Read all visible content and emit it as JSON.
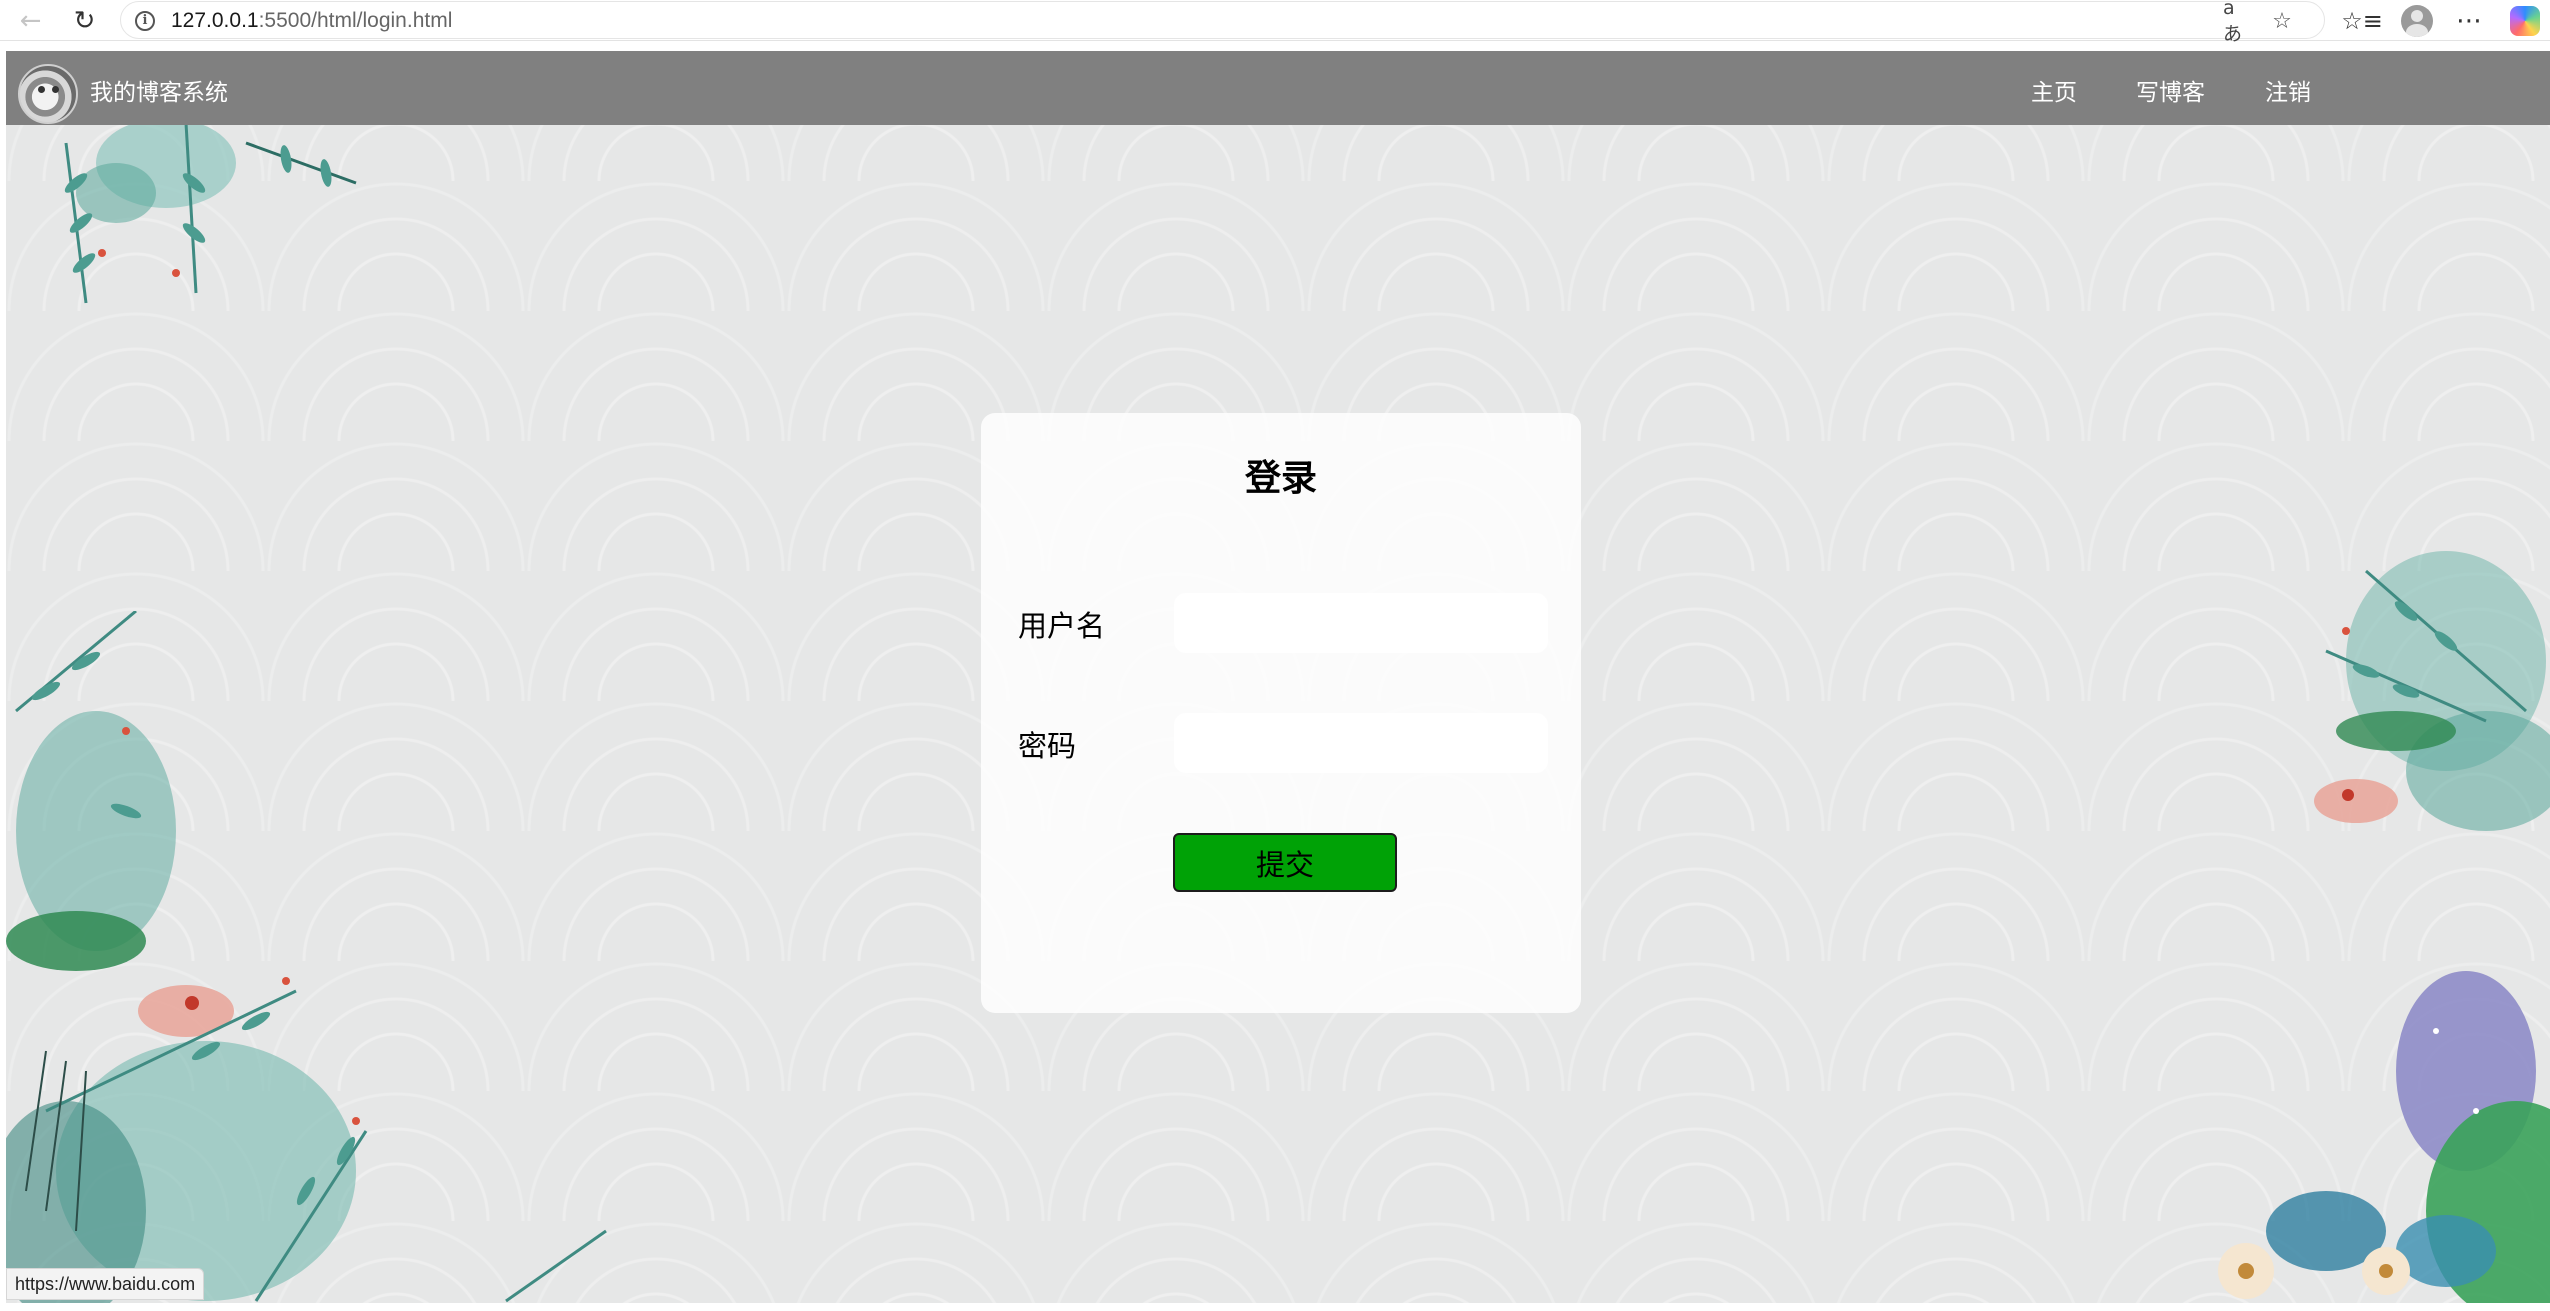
{
  "browser": {
    "url_host": "127.0.0.1",
    "url_rest": ":5500/html/login.html",
    "status_url": "https://www.baidu.com",
    "icons": [
      "back-arrow-icon",
      "reload-icon",
      "info-icon",
      "read-aloud-icon",
      "favorite-star-icon",
      "favorites-list-icon",
      "profile-avatar-icon",
      "more-menu-icon",
      "copilot-icon"
    ]
  },
  "app_nav": {
    "site_title": "我的博客系统",
    "links": [
      {
        "label": "主页"
      },
      {
        "label": "写博客"
      },
      {
        "label": "注销"
      }
    ]
  },
  "login": {
    "title": "登录",
    "username_label": "用户名",
    "username_value": "",
    "password_label": "密码",
    "password_value": "",
    "submit_label": "提交"
  },
  "colors": {
    "nav_background": "#808080",
    "page_background": "#e6e7e7",
    "submit_button": "#00a206"
  }
}
